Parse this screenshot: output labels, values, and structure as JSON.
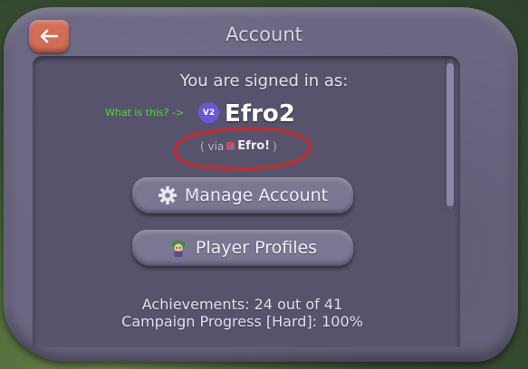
{
  "header": {
    "title": "Account",
    "back_icon": "arrow-left-icon"
  },
  "account": {
    "signed_in_label": "You are signed in as:",
    "what_is_this": "What is this? ->",
    "badge": "V2",
    "username": "Efro2",
    "via_prefix": "( via",
    "via_name": "Efro!",
    "via_suffix": ")"
  },
  "buttons": {
    "manage_account": {
      "label": "Manage Account",
      "icon": "gear-icon"
    },
    "player_profiles": {
      "label": "Player Profiles",
      "icon": "character-icon"
    }
  },
  "stats": {
    "achievements": "Achievements: 24 out of 41",
    "campaign_progress": "Campaign Progress [Hard]: 100%"
  },
  "colors": {
    "panel": "#6b6682",
    "inner_panel": "#57536d",
    "button": "#7b7792",
    "back_button": "#d26d58",
    "help_link": "#4ddc3a",
    "badge": "#6b57d8",
    "annotation": "#e0201a"
  }
}
